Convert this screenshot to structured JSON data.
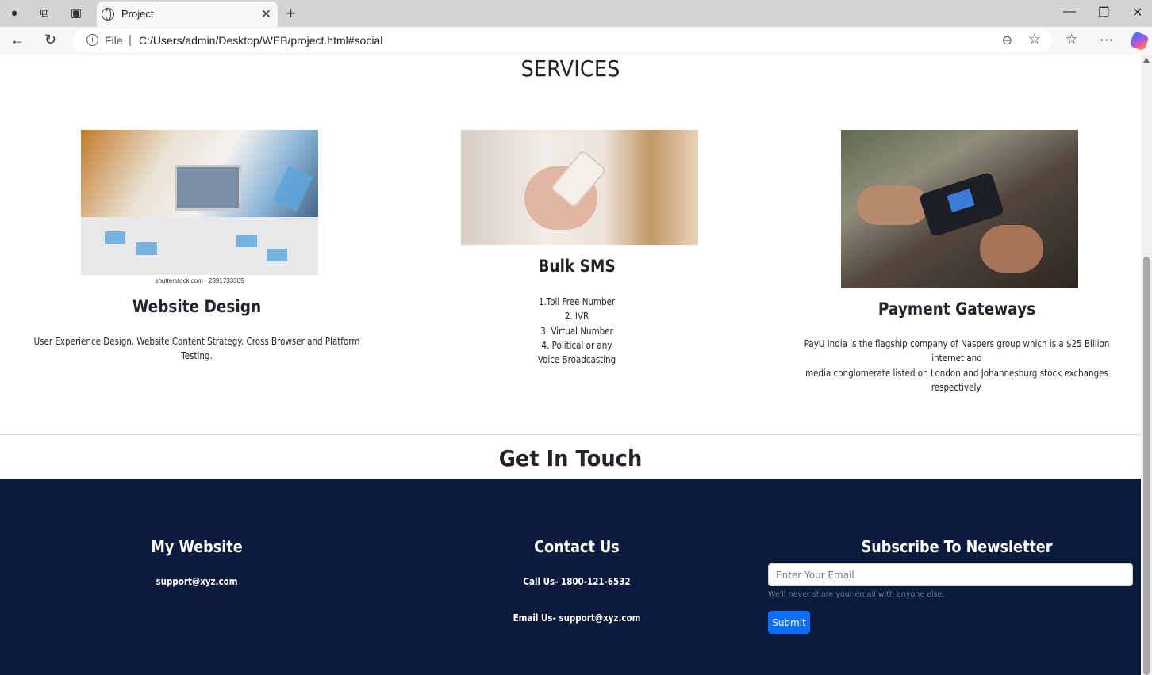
{
  "browser": {
    "tab_title": "Project",
    "address_scheme": "File",
    "address_url": "C:/Users/admin/Desktop/WEB/project.html#social"
  },
  "services": {
    "heading": "SERVICES",
    "image_credit": "shutterstock.com · 2391733305",
    "items": [
      {
        "title": "Website Design",
        "text": "User Experience Design. Website Content Strategy. Cross Browser and Platform Testing."
      },
      {
        "title": "Bulk SMS",
        "lines": [
          "1.Toll Free Number",
          "2. IVR",
          "3. Virtual Number",
          "4. Political or any",
          "Voice Broadcasting"
        ]
      },
      {
        "title": "Payment Gateways",
        "lines": [
          "PayU India is the flagship company of Naspers group which is a $25 Billion internet and",
          "media conglomerate listed on London and Johannesburg stock exchanges respectively."
        ]
      }
    ]
  },
  "touch": {
    "heading": "Get In Touch"
  },
  "footer": {
    "colors": {
      "background": "#0b1a3d",
      "button": "#0d6efd"
    },
    "website": {
      "title": "My Website",
      "email": "support@xyz.com"
    },
    "contact": {
      "title": "Contact Us",
      "phone": "Call Us- 1800-121-6532",
      "email": "Email Us- support@xyz.com"
    },
    "newsletter": {
      "title": "Subscribe To Newsletter",
      "placeholder": "Enter Your Email",
      "help": "We'll never share your email with anyone else.",
      "submit": "Submit"
    }
  }
}
